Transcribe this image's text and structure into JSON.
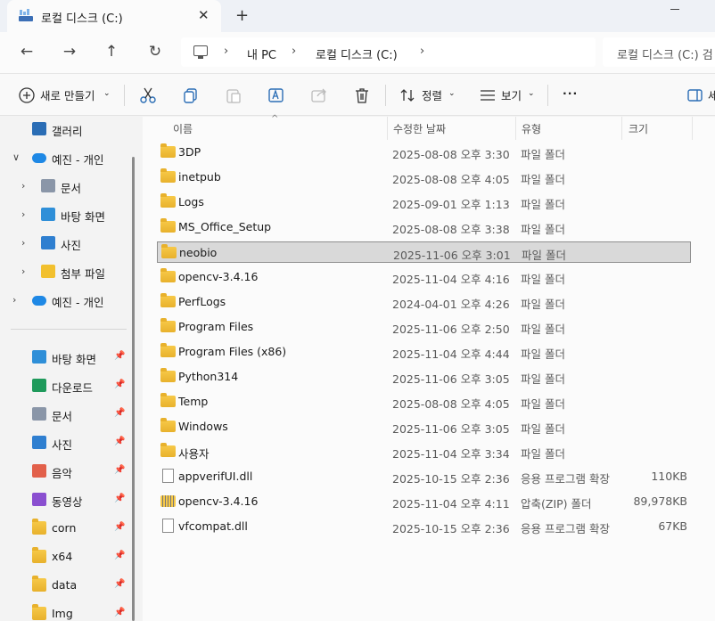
{
  "tab": {
    "title": "로컬 디스크 (C:)",
    "close": "✕",
    "new": "+"
  },
  "nav": {
    "back": "←",
    "forward": "→",
    "up": "↑",
    "refresh": "↻"
  },
  "address": {
    "sep": "›",
    "crumbs": [
      "내 PC",
      "로컬 디스크 (C:)"
    ]
  },
  "search": {
    "placeholder": "로컬 디스크 (C:) 검"
  },
  "toolbar": {
    "new_label": "새로 만들기",
    "sort_label": "정렬",
    "view_label": "보기",
    "more": "···",
    "details_label": "세"
  },
  "sidebar": {
    "items": [
      {
        "label": "갤러리",
        "icon": "gallery-icon"
      },
      {
        "label": "예진 - 개인",
        "icon": "onedrive-icon",
        "expanded": true
      },
      {
        "label": "문서",
        "icon": "document-icon"
      },
      {
        "label": "바탕 화면",
        "icon": "desktop-icon"
      },
      {
        "label": "사진",
        "icon": "pictures-icon"
      },
      {
        "label": "첨부 파일",
        "icon": "folder-icon"
      },
      {
        "label": "예진 - 개인",
        "icon": "onedrive-icon"
      }
    ],
    "quick": [
      {
        "label": "바탕 화면",
        "icon": "desktop-icon"
      },
      {
        "label": "다운로드",
        "icon": "download-icon"
      },
      {
        "label": "문서",
        "icon": "document-icon"
      },
      {
        "label": "사진",
        "icon": "pictures-icon"
      },
      {
        "label": "음악",
        "icon": "music-icon"
      },
      {
        "label": "동영상",
        "icon": "video-icon"
      },
      {
        "label": "corn",
        "icon": "folder-icon"
      },
      {
        "label": "x64",
        "icon": "folder-icon"
      },
      {
        "label": "data",
        "icon": "folder-icon"
      },
      {
        "label": "Img",
        "icon": "folder-icon"
      }
    ],
    "pin": "📌"
  },
  "columns": {
    "name": "이름",
    "modified": "수정한 날짜",
    "type": "유형",
    "size": "크기"
  },
  "files": [
    {
      "name": "3DP",
      "date": "2025-08-08 오후 3:30",
      "type": "파일 폴더",
      "size": "",
      "kind": "folder"
    },
    {
      "name": "inetpub",
      "date": "2025-08-08 오후 4:05",
      "type": "파일 폴더",
      "size": "",
      "kind": "folder"
    },
    {
      "name": "Logs",
      "date": "2025-09-01 오후 1:13",
      "type": "파일 폴더",
      "size": "",
      "kind": "folder"
    },
    {
      "name": "MS_Office_Setup",
      "date": "2025-08-08 오후 3:38",
      "type": "파일 폴더",
      "size": "",
      "kind": "folder"
    },
    {
      "name": "neobio",
      "date": "2025-11-06 오후 3:01",
      "type": "파일 폴더",
      "size": "",
      "kind": "folder",
      "selected": true
    },
    {
      "name": "opencv-3.4.16",
      "date": "2025-11-04 오후 4:16",
      "type": "파일 폴더",
      "size": "",
      "kind": "folder"
    },
    {
      "name": "PerfLogs",
      "date": "2024-04-01 오후 4:26",
      "type": "파일 폴더",
      "size": "",
      "kind": "folder"
    },
    {
      "name": "Program Files",
      "date": "2025-11-06 오후 2:50",
      "type": "파일 폴더",
      "size": "",
      "kind": "folder"
    },
    {
      "name": "Program Files (x86)",
      "date": "2025-11-04 오후 4:44",
      "type": "파일 폴더",
      "size": "",
      "kind": "folder"
    },
    {
      "name": "Python314",
      "date": "2025-11-06 오후 3:05",
      "type": "파일 폴더",
      "size": "",
      "kind": "folder"
    },
    {
      "name": "Temp",
      "date": "2025-08-08 오후 4:05",
      "type": "파일 폴더",
      "size": "",
      "kind": "folder"
    },
    {
      "name": "Windows",
      "date": "2025-11-06 오후 3:05",
      "type": "파일 폴더",
      "size": "",
      "kind": "folder"
    },
    {
      "name": "사용자",
      "date": "2025-11-04 오후 3:34",
      "type": "파일 폴더",
      "size": "",
      "kind": "folder"
    },
    {
      "name": "appverifUI.dll",
      "date": "2025-10-15 오후 2:36",
      "type": "응용 프로그램 확장",
      "size": "110KB",
      "kind": "file"
    },
    {
      "name": "opencv-3.4.16",
      "date": "2025-11-04 오후 4:11",
      "type": "압축(ZIP) 폴더",
      "size": "89,978KB",
      "kind": "zip"
    },
    {
      "name": "vfcompat.dll",
      "date": "2025-10-15 오후 2:36",
      "type": "응용 프로그램 확장",
      "size": "67KB",
      "kind": "file"
    }
  ],
  "colors": {
    "accent": "#0067c0",
    "folder": "#f2c02e",
    "selected_bg": "#d9d9d9"
  }
}
